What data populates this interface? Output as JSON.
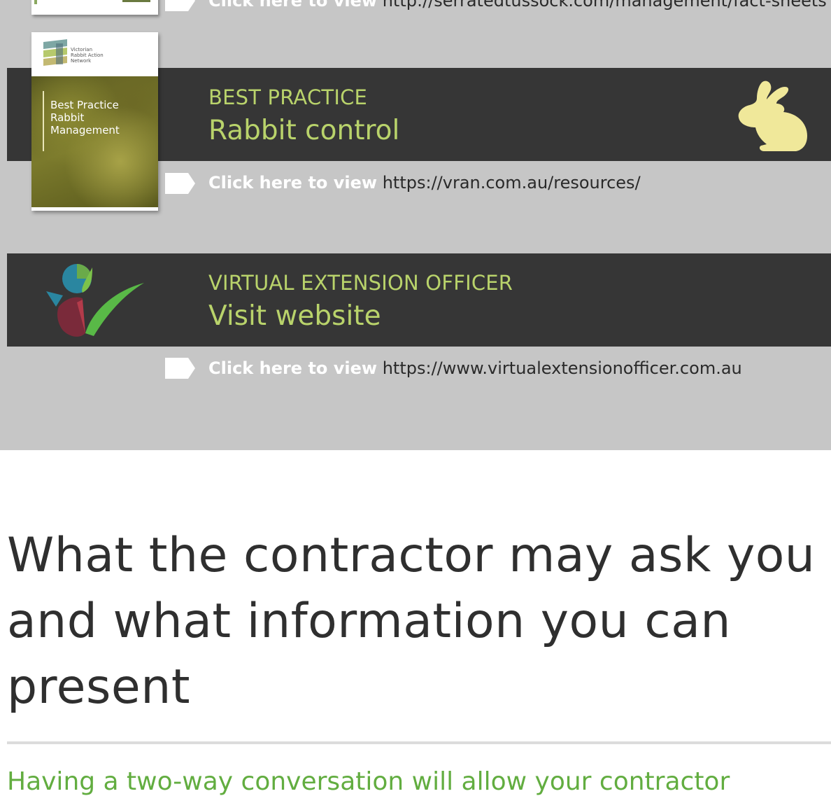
{
  "top_item": {
    "link": {
      "cta": "Click here to view",
      "url": "http://serratedtussock.com/management/fact-sheets"
    }
  },
  "rabbit_item": {
    "category": "BEST PRACTICE",
    "headline": "Rabbit control",
    "cover": {
      "org_lines": [
        "Victorian",
        "Rabbit Action",
        "Network"
      ],
      "title": "Best Practice Rabbit Management"
    },
    "link": {
      "cta": "Click here to view",
      "url": "https://vran.com.au/resources/"
    }
  },
  "veo_item": {
    "category": "VIRTUAL EXTENSION OFFICER",
    "headline": "Visit website",
    "link": {
      "cta": "Click here to view",
      "url": "https://www.virtualextensionofficer.com.au"
    }
  },
  "section": {
    "heading": "What the contractor may ask you and what information you can present",
    "subheading": "Having a two-way conversation will allow your contractor"
  },
  "colors": {
    "panel_grey": "#c6c6c6",
    "band_dark": "#363636",
    "accent_lime": "#b9d36b",
    "accent_green": "#62ad40",
    "rabbit_yellow": "#f0e89a"
  },
  "icons": {
    "arrow": "arrow-tag-icon",
    "rabbit": "rabbit-icon",
    "veo": "veo-logo-icon"
  }
}
